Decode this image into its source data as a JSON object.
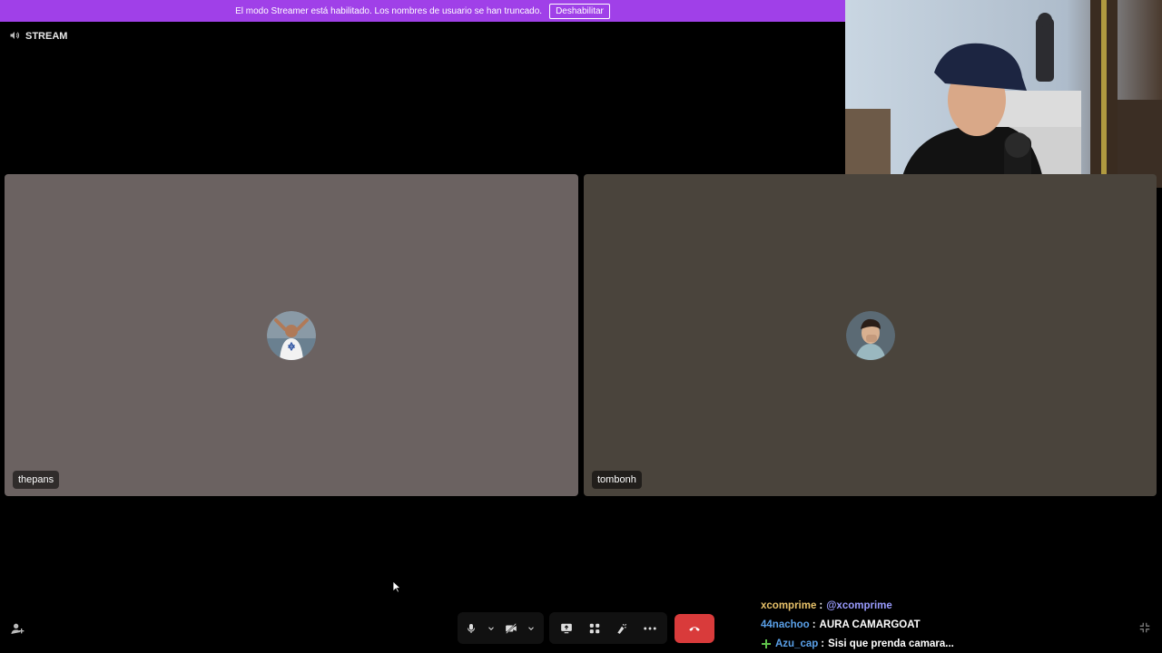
{
  "banner": {
    "message": "El modo Streamer está habilitado. Los nombres de usuario se han truncado.",
    "button_label": "Deshabilitar",
    "color": "#a040e8"
  },
  "channel": {
    "name": "STREAM",
    "icon": "speaker-icon"
  },
  "participants": [
    {
      "name": "thepans",
      "tile_color": "#6b6261"
    },
    {
      "name": "tombonh",
      "tile_color": "#4a443c"
    }
  ],
  "controls": {
    "icons": [
      "microphone-icon",
      "chevron-down-icon",
      "camera-off-icon",
      "chevron-down-icon",
      "screen-share-icon",
      "activities-icon",
      "soundboard-icon",
      "more-icon",
      "hang-up-icon"
    ],
    "hangup_color": "#d93b3b"
  },
  "chat": [
    {
      "user": "xcomprime",
      "user_color": "#e8c26a",
      "sep": ":",
      "message": "@xcomprime",
      "mention": true
    },
    {
      "user": "44nachoo",
      "user_color": "#5aa0e8",
      "sep": ":",
      "message": "AURA CAMARGOAT",
      "mention": false
    },
    {
      "user": "Azu_cap",
      "user_color": "#5aa0e8",
      "sep": ":",
      "message": "Sisi que prenda camara...",
      "mention": false,
      "badge": "plus-badge-icon"
    }
  ]
}
